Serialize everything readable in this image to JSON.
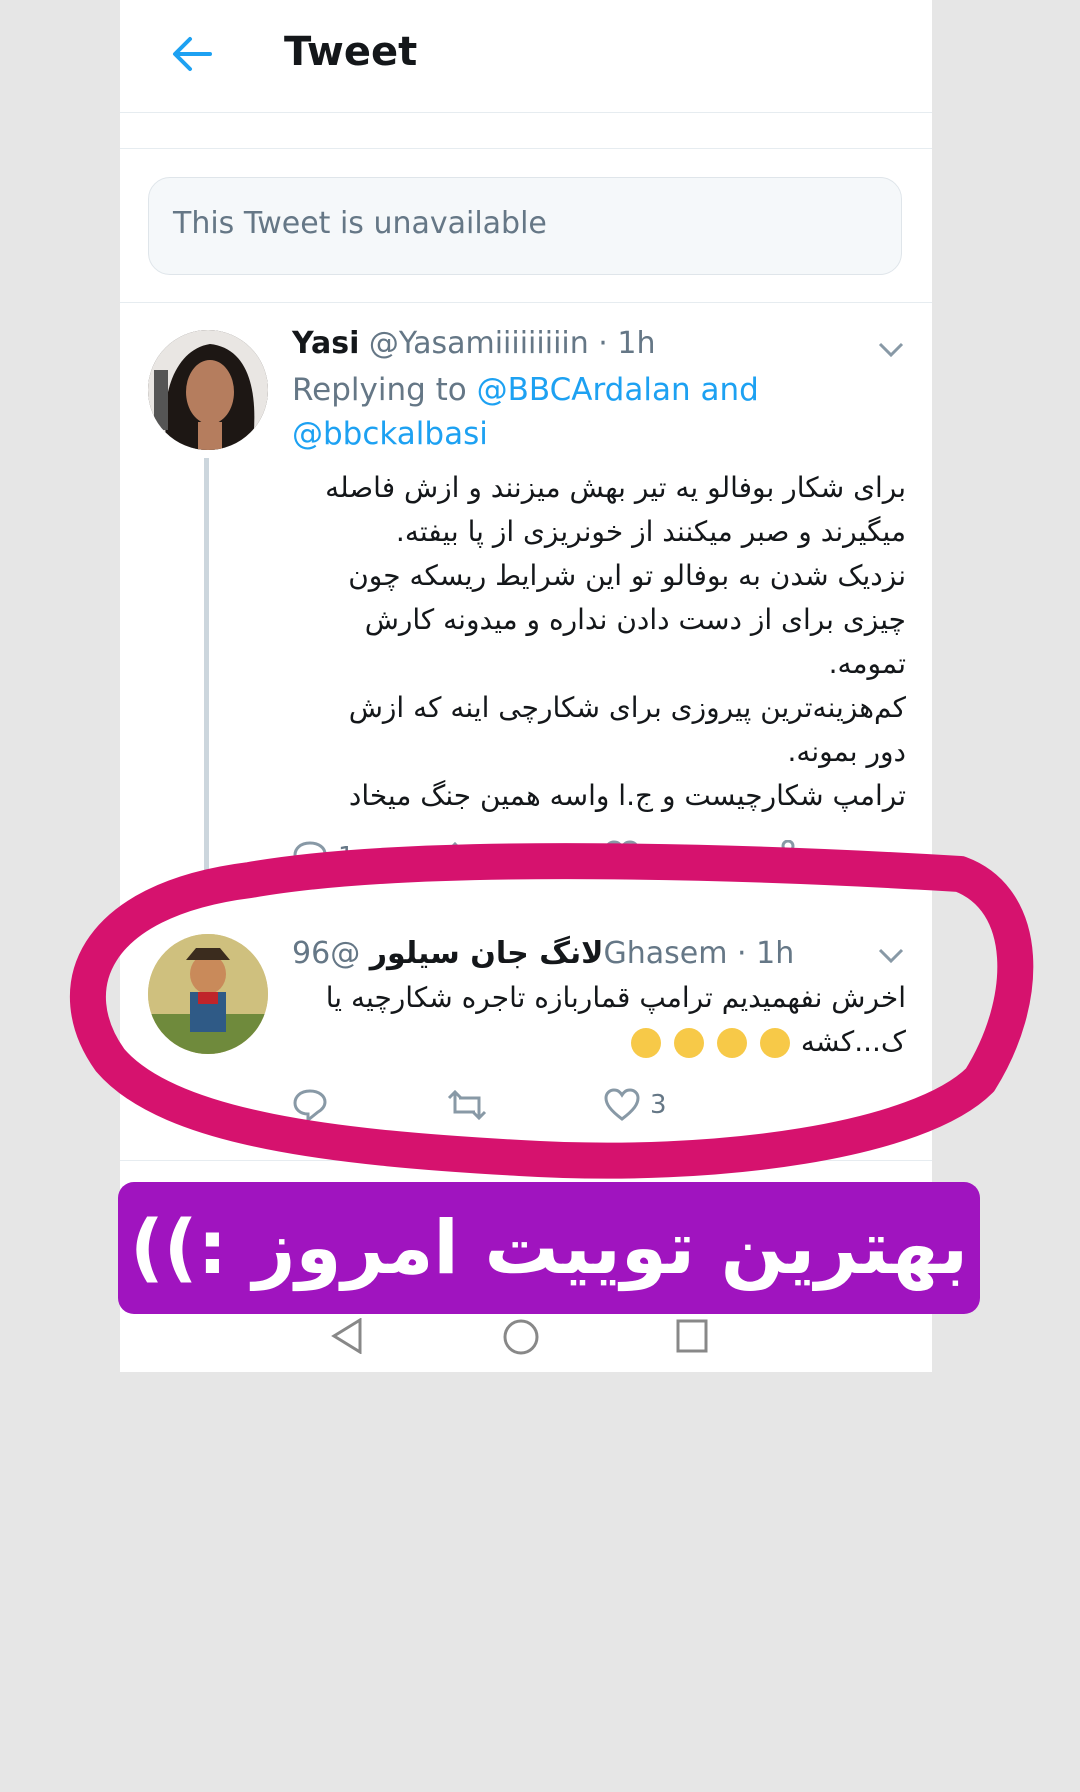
{
  "header": {
    "title": "Tweet",
    "back_icon": "arrow-left-icon"
  },
  "unavailable_notice": "This Tweet is unavailable",
  "tweet1": {
    "name": "Yasi",
    "handle": "@Yasamiiiiiiiiin",
    "time": "· 1h",
    "replying_prefix": "Replying to",
    "replying_to": "@BBCArdalan and @bbckalbasi",
    "body_lines": [
      "برای شکار بوفالو یه تیر بهش میزنند و ازش فاصله",
      "میگیرند و صبر میکنند از خونریزی از پا بیفته.",
      "نزدیک شدن به بوفالو تو این شرایط ریسکه چون",
      "چیزی برای از دست دادن نداره و میدونه کارش",
      "تمومه.",
      "کم‌هزینه‌ترین پیروزی برای شکارچی اینه که ازش",
      "دور بمونه.",
      "ترامپ شکارچیست و ج.ا واسه همین جنگ میخاد"
    ],
    "reply_count": "1"
  },
  "tweet2": {
    "name": "لانگ جان سیلور",
    "handle": "@96Ghasem",
    "time": "· 1h",
    "body_lines": [
      "اخرش نفهمیدیم ترامپ قماربازه تاجره شکارچیه یا",
      "ک...کشه"
    ],
    "like_count": "3"
  },
  "banner": {
    "text": "بهترین توییت امروز :))"
  },
  "colors": {
    "accent": "#1da1f2",
    "highlight_circle": "#d6126e",
    "banner_bg": "#a014bf"
  }
}
